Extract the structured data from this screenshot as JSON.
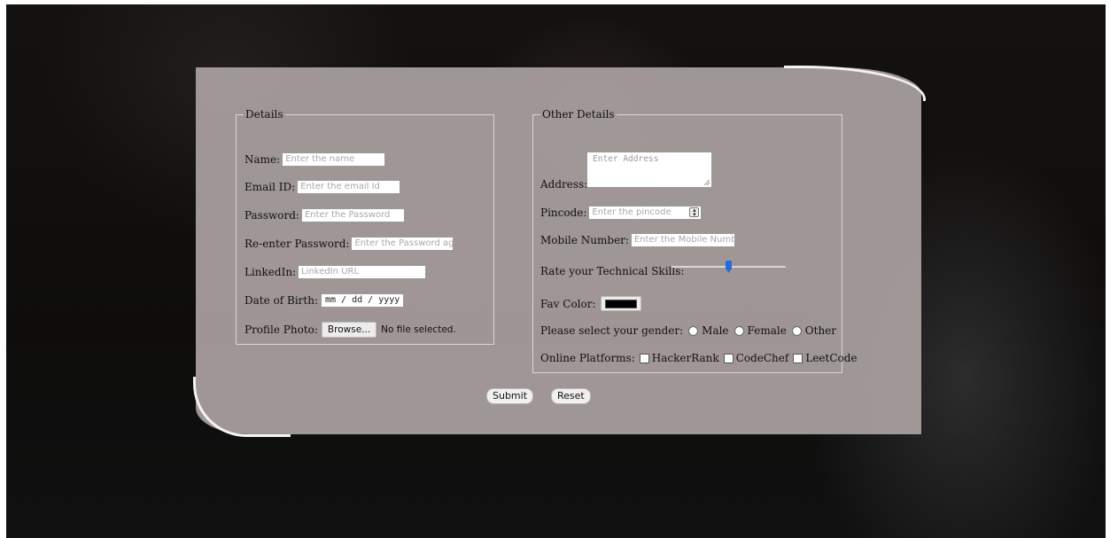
{
  "details": {
    "legend": "Details",
    "name_label": "Name:",
    "name_placeholder": "Enter the name",
    "email_label": "Email ID:",
    "email_placeholder": "Enter the email Id",
    "password_label": "Password:",
    "password_placeholder": "Enter the Password",
    "reenter_label": "Re-enter Password:",
    "reenter_placeholder": "Enter the Password aga",
    "linkedin_label": "LinkedIn:",
    "linkedin_placeholder": "LinkedIn URL",
    "dob_label": "Date of Birth:",
    "dob_placeholder": "mm / dd / yyyy",
    "photo_label": "Profile Photo:",
    "browse_label": "Browse...",
    "no_file_text": "No file selected."
  },
  "other": {
    "legend": "Other Details",
    "address_label": "Address:",
    "address_placeholder": "Enter Address",
    "pincode_label": "Pincode:",
    "pincode_placeholder": "Enter the pincode",
    "mobile_label": "Mobile Number:",
    "mobile_placeholder": "Enter the Mobile Numbe",
    "rate_label": "Rate your Technical Skills:",
    "rate_value_fraction": 0.5,
    "fav_color_label": "Fav Color:",
    "fav_color_value": "#000000",
    "gender_label": "Please select your gender:",
    "gender_options": [
      "Male",
      "Female",
      "Other"
    ],
    "platforms_label": "Online Platforms:",
    "platform_options": [
      "HackerRank",
      "CodeChef",
      "LeetCode"
    ]
  },
  "actions": {
    "submit_label": "Submit",
    "reset_label": "Reset"
  },
  "colors": {
    "card": "#aaa0a0",
    "slider_thumb": "#1f6ed8",
    "background": "#121110"
  }
}
